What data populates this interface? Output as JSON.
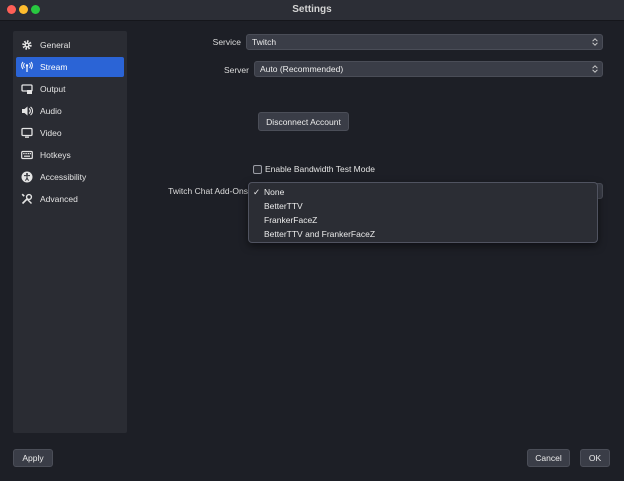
{
  "window": {
    "title": "Settings"
  },
  "sidebar": {
    "items": [
      {
        "label": "General",
        "icon": "gear-icon"
      },
      {
        "label": "Stream",
        "icon": "antenna-icon",
        "active": true
      },
      {
        "label": "Output",
        "icon": "output-icon"
      },
      {
        "label": "Audio",
        "icon": "speaker-icon"
      },
      {
        "label": "Video",
        "icon": "monitor-icon"
      },
      {
        "label": "Hotkeys",
        "icon": "keyboard-icon"
      },
      {
        "label": "Accessibility",
        "icon": "accessibility-icon"
      },
      {
        "label": "Advanced",
        "icon": "wrench-icon"
      }
    ]
  },
  "stream": {
    "service_label": "Service",
    "service_value": "Twitch",
    "server_label": "Server",
    "server_value": "Auto (Recommended)",
    "disconnect_label": "Disconnect Account",
    "bandwidth_label": "Enable Bandwidth Test Mode",
    "bandwidth_checked": false,
    "addons_label": "Twitch Chat Add-Ons",
    "addons_options": [
      {
        "label": "None",
        "selected": true
      },
      {
        "label": "BetterTTV",
        "selected": false
      },
      {
        "label": "FrankerFaceZ",
        "selected": false
      },
      {
        "label": "BetterTTV and FrankerFaceZ",
        "selected": false
      }
    ]
  },
  "footer": {
    "apply_label": "Apply",
    "cancel_label": "Cancel",
    "ok_label": "OK"
  },
  "colors": {
    "accent": "#2b64d6",
    "background": "#1d1f26",
    "sidebar": "#2a2c33"
  }
}
